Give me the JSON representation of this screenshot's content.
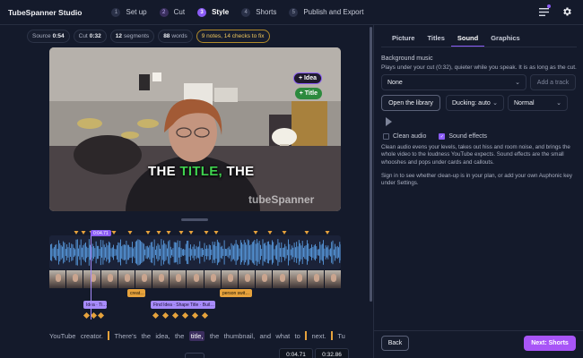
{
  "app": {
    "title": "TubeSpanner Studio"
  },
  "steps": [
    {
      "num": "1",
      "label": "Set up"
    },
    {
      "num": "2",
      "label": "Cut"
    },
    {
      "num": "3",
      "label": "Style"
    },
    {
      "num": "4",
      "label": "Shorts"
    },
    {
      "num": "5",
      "label": "Publish and Export"
    }
  ],
  "active_step": 2,
  "stats": {
    "source_label": "Source",
    "source_value": "0:54",
    "cut_label": "Cut",
    "cut_value": "0:32",
    "segments_value": "12",
    "segments_label": "segments",
    "words_value": "88",
    "words_label": "words",
    "alert": "9 notes, 14 checks to fix"
  },
  "video": {
    "bubble_idea": "+ Idea",
    "bubble_title": "+ Title",
    "caption_pre": "THE ",
    "caption_hl": "TITLE,",
    "caption_post": " THE",
    "watermark": "tubeSpanner"
  },
  "timeline": {
    "playhead": "0:04.71",
    "chip_create": "creat…",
    "chip_person": "person swit…",
    "chip_idea": "Idea · Ti…",
    "chip_find": "Find Idea · Shape Title · Buil…"
  },
  "transcript": {
    "words": [
      "YouTube",
      "creator.",
      "There's",
      "the",
      "idea,",
      "the"
    ],
    "current": "title,",
    "after": [
      "the",
      "thumbnail,",
      "and",
      "what",
      "to"
    ],
    "end": [
      "next.",
      "Tu"
    ]
  },
  "times": {
    "current": "0:04.71",
    "total": "0:32.86"
  },
  "right": {
    "tabs": [
      "Picture",
      "Titles",
      "Sound",
      "Graphics"
    ],
    "active_tab": 2,
    "bg_title": "Background music",
    "bg_sub": "Plays under your cut (0:32), quieter while you speak. It is as long as the cut.",
    "music_select": "None",
    "add_track": "Add a track",
    "open_library": "Open the library",
    "ducking": "Ducking: auto",
    "level": "Normal",
    "clean_audio": "Clean audio",
    "sound_effects": "Sound effects",
    "help1": "Clean audio evens your levels, takes out hiss and room noise, and brings the whole video to the loudness YouTube expects. Sound effects are the small whooshes and pops under cards and callouts.",
    "help2": "Sign in to see whether clean-up is in your plan, or add your own Auphonic key under Settings.",
    "back": "Back",
    "next": "Next: Shorts"
  },
  "colors": {
    "accent": "#8b5cf6",
    "next_button": "#a855f7",
    "caption_highlight": "#3fd24f",
    "marker": "#e6a23c"
  },
  "icons": {
    "menu": "menu-icon",
    "settings": "gear-icon"
  }
}
